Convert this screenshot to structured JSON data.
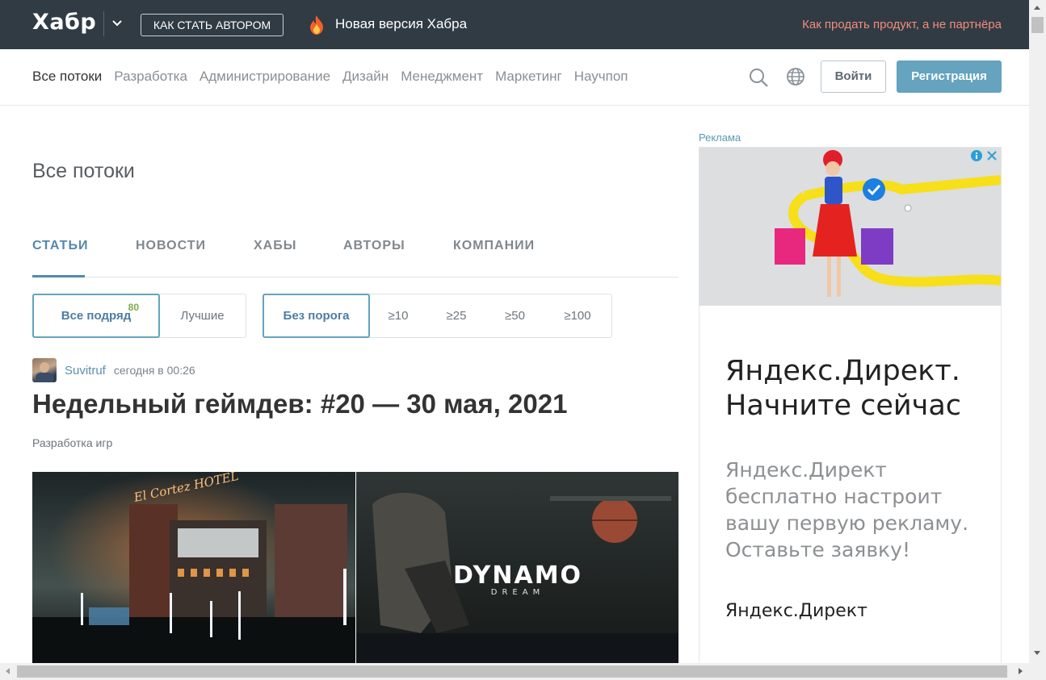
{
  "header": {
    "logo": "Хабр",
    "author_button": "КАК СТАТЬ АВТОРОМ",
    "announcement": "Новая версия Хабра",
    "promo_link": "Как продать продукт, а не партнёра"
  },
  "nav": {
    "items": [
      "Все потоки",
      "Разработка",
      "Администрирование",
      "Дизайн",
      "Менеджмент",
      "Маркетинг",
      "Научпоп"
    ],
    "login": "Войти",
    "register": "Регистрация"
  },
  "page": {
    "title": "Все потоки",
    "tabs": [
      "СТАТЬИ",
      "НОВОСТИ",
      "ХАБЫ",
      "АВТОРЫ",
      "КОМПАНИИ"
    ],
    "filters_sort": [
      {
        "label": "Все подряд",
        "count": "80"
      },
      {
        "label": "Лучшие",
        "count": ""
      }
    ],
    "filters_threshold": [
      "Без порога",
      "≥10",
      "≥25",
      "≥50",
      "≥100"
    ]
  },
  "post": {
    "author": "Suvitruf",
    "time": "сегодня в 00:26",
    "title": "Недельный геймдев: #20 — 30 мая, 2021",
    "hub": "Разработка игр",
    "image_text_left": "El Cortez HOTEL",
    "image_text_right": "DYNAMO",
    "image_text_right_sub": "DREAM"
  },
  "ad": {
    "label": "Реклама",
    "headline": "Яндекс.Директ. Начните сейчас",
    "body": "Яндекс.Директ бесплатно настроит вашу первую рекламу. Оставьте заявку!",
    "brand": "Яндекс.Директ"
  },
  "colors": {
    "topbar": "#303b44",
    "accent": "#65a3be",
    "link": "#5488ad",
    "promo": "#f38c7c"
  }
}
